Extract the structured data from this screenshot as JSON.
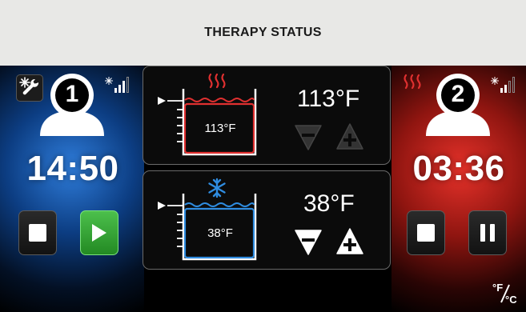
{
  "header": {
    "title": "THERAPY STATUS"
  },
  "left": {
    "zone_number": "1",
    "timer": "14:50",
    "mode": "cold",
    "glow_color": "#2f7ddb",
    "buttons": {
      "stop": "stop-icon",
      "play": "play-icon"
    },
    "tool_icon": "snowflake-wrench-icon",
    "signal_icon": "signal-strength-icon"
  },
  "right": {
    "zone_number": "2",
    "timer": "03:36",
    "mode": "hot",
    "glow_color": "#e7322a",
    "buttons": {
      "stop": "stop-icon",
      "pause": "pause-icon"
    },
    "signal_icon": "signal-strength-icon"
  },
  "hot_panel": {
    "set_temp": "113°F",
    "tank_temp": "113°F",
    "icon": "heat-waves-icon",
    "accent": "#e03030",
    "decrease_enabled": false,
    "increase_enabled": false
  },
  "cold_panel": {
    "set_temp": "38°F",
    "tank_temp": "38°F",
    "icon": "snowflake-icon",
    "accent": "#2f8ce0",
    "decrease_enabled": true,
    "increase_enabled": true
  },
  "unit_toggle": {
    "icon": "fahrenheit-celsius-toggle-icon"
  }
}
